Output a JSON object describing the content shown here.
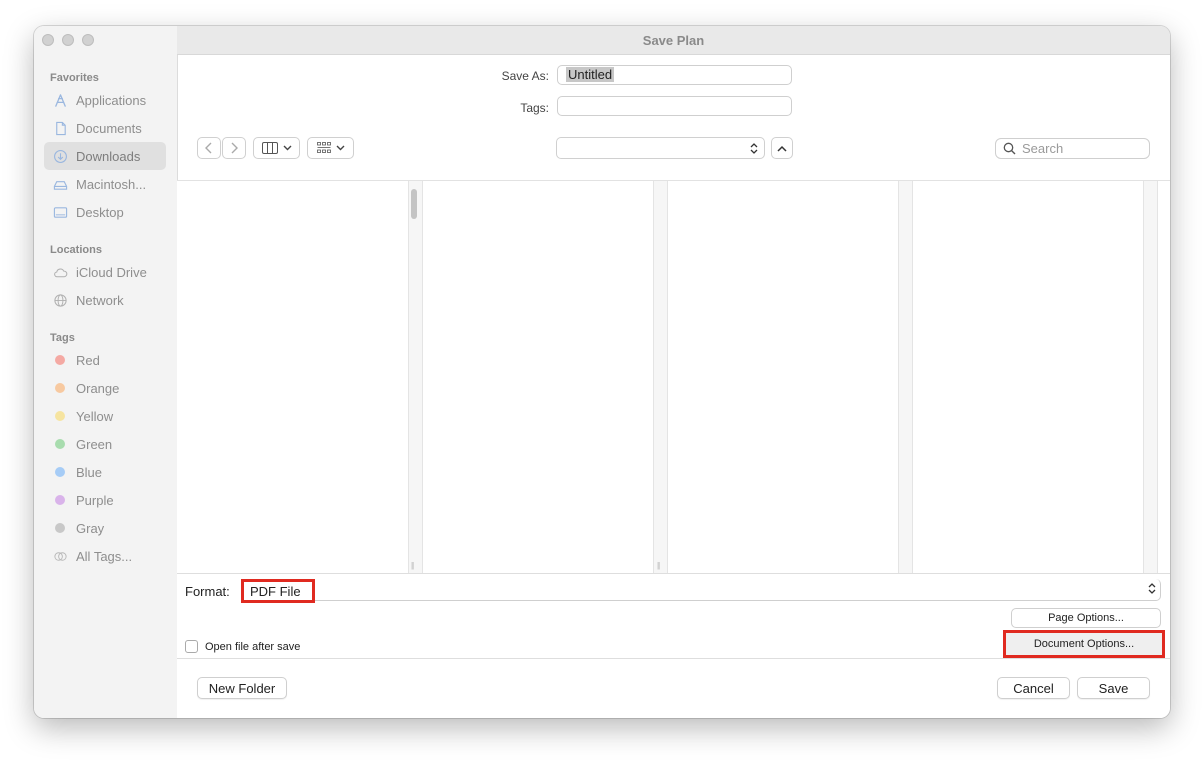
{
  "window": {
    "title": "Save Plan"
  },
  "sidebar": {
    "favorites_title": "Favorites",
    "favorites": [
      {
        "label": "Applications",
        "icon": "applications-icon"
      },
      {
        "label": "Documents",
        "icon": "document-icon"
      },
      {
        "label": "Downloads",
        "icon": "downloads-icon",
        "selected": true
      },
      {
        "label": "Macintosh...",
        "icon": "disk-icon"
      },
      {
        "label": "Desktop",
        "icon": "desktop-icon"
      }
    ],
    "locations_title": "Locations",
    "locations": [
      {
        "label": "iCloud Drive",
        "icon": "cloud-icon"
      },
      {
        "label": "Network",
        "icon": "network-icon"
      }
    ],
    "tags_title": "Tags",
    "tags": [
      {
        "label": "Red",
        "color": "#f4a9a3"
      },
      {
        "label": "Orange",
        "color": "#f7c9a0"
      },
      {
        "label": "Yellow",
        "color": "#f6e4a0"
      },
      {
        "label": "Green",
        "color": "#a8dcae"
      },
      {
        "label": "Blue",
        "color": "#a6ccf6"
      },
      {
        "label": "Purple",
        "color": "#d9b3ea"
      },
      {
        "label": "Gray",
        "color": "#c8c8c8"
      },
      {
        "label": "All Tags...",
        "icon": "all-tags-icon"
      }
    ]
  },
  "form": {
    "save_as_label": "Save As:",
    "save_as_value": "Untitled",
    "tags_label": "Tags:",
    "tags_value": ""
  },
  "toolbar": {
    "back_icon": "chevron-left-icon",
    "forward_icon": "chevron-right-icon",
    "view_icon": "column-view-icon",
    "group_icon": "grid-view-icon",
    "location_value": "",
    "search_placeholder": "Search"
  },
  "format": {
    "label": "Format:",
    "value": "PDF File",
    "page_options": "Page Options...",
    "document_options": "Document Options...",
    "open_after_save": "Open file after save",
    "open_after_save_checked": false
  },
  "bottom": {
    "new_folder": "New Folder",
    "cancel": "Cancel",
    "save": "Save"
  },
  "colors": {
    "highlight": "#e02a20"
  }
}
